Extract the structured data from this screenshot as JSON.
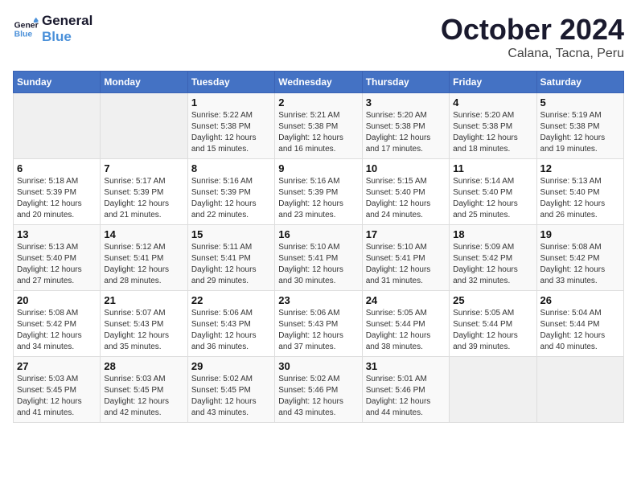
{
  "header": {
    "logo_line1": "General",
    "logo_line2": "Blue",
    "month": "October 2024",
    "location": "Calana, Tacna, Peru"
  },
  "weekdays": [
    "Sunday",
    "Monday",
    "Tuesday",
    "Wednesday",
    "Thursday",
    "Friday",
    "Saturday"
  ],
  "weeks": [
    [
      {
        "day": "",
        "sunrise": "",
        "sunset": "",
        "daylight": ""
      },
      {
        "day": "",
        "sunrise": "",
        "sunset": "",
        "daylight": ""
      },
      {
        "day": "1",
        "sunrise": "Sunrise: 5:22 AM",
        "sunset": "Sunset: 5:38 PM",
        "daylight": "Daylight: 12 hours and 15 minutes."
      },
      {
        "day": "2",
        "sunrise": "Sunrise: 5:21 AM",
        "sunset": "Sunset: 5:38 PM",
        "daylight": "Daylight: 12 hours and 16 minutes."
      },
      {
        "day": "3",
        "sunrise": "Sunrise: 5:20 AM",
        "sunset": "Sunset: 5:38 PM",
        "daylight": "Daylight: 12 hours and 17 minutes."
      },
      {
        "day": "4",
        "sunrise": "Sunrise: 5:20 AM",
        "sunset": "Sunset: 5:38 PM",
        "daylight": "Daylight: 12 hours and 18 minutes."
      },
      {
        "day": "5",
        "sunrise": "Sunrise: 5:19 AM",
        "sunset": "Sunset: 5:38 PM",
        "daylight": "Daylight: 12 hours and 19 minutes."
      }
    ],
    [
      {
        "day": "6",
        "sunrise": "Sunrise: 5:18 AM",
        "sunset": "Sunset: 5:39 PM",
        "daylight": "Daylight: 12 hours and 20 minutes."
      },
      {
        "day": "7",
        "sunrise": "Sunrise: 5:17 AM",
        "sunset": "Sunset: 5:39 PM",
        "daylight": "Daylight: 12 hours and 21 minutes."
      },
      {
        "day": "8",
        "sunrise": "Sunrise: 5:16 AM",
        "sunset": "Sunset: 5:39 PM",
        "daylight": "Daylight: 12 hours and 22 minutes."
      },
      {
        "day": "9",
        "sunrise": "Sunrise: 5:16 AM",
        "sunset": "Sunset: 5:39 PM",
        "daylight": "Daylight: 12 hours and 23 minutes."
      },
      {
        "day": "10",
        "sunrise": "Sunrise: 5:15 AM",
        "sunset": "Sunset: 5:40 PM",
        "daylight": "Daylight: 12 hours and 24 minutes."
      },
      {
        "day": "11",
        "sunrise": "Sunrise: 5:14 AM",
        "sunset": "Sunset: 5:40 PM",
        "daylight": "Daylight: 12 hours and 25 minutes."
      },
      {
        "day": "12",
        "sunrise": "Sunrise: 5:13 AM",
        "sunset": "Sunset: 5:40 PM",
        "daylight": "Daylight: 12 hours and 26 minutes."
      }
    ],
    [
      {
        "day": "13",
        "sunrise": "Sunrise: 5:13 AM",
        "sunset": "Sunset: 5:40 PM",
        "daylight": "Daylight: 12 hours and 27 minutes."
      },
      {
        "day": "14",
        "sunrise": "Sunrise: 5:12 AM",
        "sunset": "Sunset: 5:41 PM",
        "daylight": "Daylight: 12 hours and 28 minutes."
      },
      {
        "day": "15",
        "sunrise": "Sunrise: 5:11 AM",
        "sunset": "Sunset: 5:41 PM",
        "daylight": "Daylight: 12 hours and 29 minutes."
      },
      {
        "day": "16",
        "sunrise": "Sunrise: 5:10 AM",
        "sunset": "Sunset: 5:41 PM",
        "daylight": "Daylight: 12 hours and 30 minutes."
      },
      {
        "day": "17",
        "sunrise": "Sunrise: 5:10 AM",
        "sunset": "Sunset: 5:41 PM",
        "daylight": "Daylight: 12 hours and 31 minutes."
      },
      {
        "day": "18",
        "sunrise": "Sunrise: 5:09 AM",
        "sunset": "Sunset: 5:42 PM",
        "daylight": "Daylight: 12 hours and 32 minutes."
      },
      {
        "day": "19",
        "sunrise": "Sunrise: 5:08 AM",
        "sunset": "Sunset: 5:42 PM",
        "daylight": "Daylight: 12 hours and 33 minutes."
      }
    ],
    [
      {
        "day": "20",
        "sunrise": "Sunrise: 5:08 AM",
        "sunset": "Sunset: 5:42 PM",
        "daylight": "Daylight: 12 hours and 34 minutes."
      },
      {
        "day": "21",
        "sunrise": "Sunrise: 5:07 AM",
        "sunset": "Sunset: 5:43 PM",
        "daylight": "Daylight: 12 hours and 35 minutes."
      },
      {
        "day": "22",
        "sunrise": "Sunrise: 5:06 AM",
        "sunset": "Sunset: 5:43 PM",
        "daylight": "Daylight: 12 hours and 36 minutes."
      },
      {
        "day": "23",
        "sunrise": "Sunrise: 5:06 AM",
        "sunset": "Sunset: 5:43 PM",
        "daylight": "Daylight: 12 hours and 37 minutes."
      },
      {
        "day": "24",
        "sunrise": "Sunrise: 5:05 AM",
        "sunset": "Sunset: 5:44 PM",
        "daylight": "Daylight: 12 hours and 38 minutes."
      },
      {
        "day": "25",
        "sunrise": "Sunrise: 5:05 AM",
        "sunset": "Sunset: 5:44 PM",
        "daylight": "Daylight: 12 hours and 39 minutes."
      },
      {
        "day": "26",
        "sunrise": "Sunrise: 5:04 AM",
        "sunset": "Sunset: 5:44 PM",
        "daylight": "Daylight: 12 hours and 40 minutes."
      }
    ],
    [
      {
        "day": "27",
        "sunrise": "Sunrise: 5:03 AM",
        "sunset": "Sunset: 5:45 PM",
        "daylight": "Daylight: 12 hours and 41 minutes."
      },
      {
        "day": "28",
        "sunrise": "Sunrise: 5:03 AM",
        "sunset": "Sunset: 5:45 PM",
        "daylight": "Daylight: 12 hours and 42 minutes."
      },
      {
        "day": "29",
        "sunrise": "Sunrise: 5:02 AM",
        "sunset": "Sunset: 5:45 PM",
        "daylight": "Daylight: 12 hours and 43 minutes."
      },
      {
        "day": "30",
        "sunrise": "Sunrise: 5:02 AM",
        "sunset": "Sunset: 5:46 PM",
        "daylight": "Daylight: 12 hours and 43 minutes."
      },
      {
        "day": "31",
        "sunrise": "Sunrise: 5:01 AM",
        "sunset": "Sunset: 5:46 PM",
        "daylight": "Daylight: 12 hours and 44 minutes."
      },
      {
        "day": "",
        "sunrise": "",
        "sunset": "",
        "daylight": ""
      },
      {
        "day": "",
        "sunrise": "",
        "sunset": "",
        "daylight": ""
      }
    ]
  ]
}
